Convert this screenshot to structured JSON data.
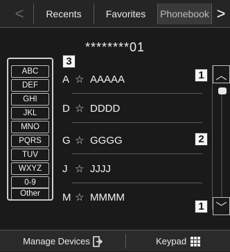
{
  "tabs": {
    "back": "<",
    "recents": "Recents",
    "favorites": "Favorites",
    "phonebook": "Phonebook",
    "forward": ">"
  },
  "phone_number": "********01",
  "index_items": [
    "ABC",
    "DEF",
    "GHI",
    "JKL",
    "MNO",
    "PQRS",
    "TUV",
    "WXYZ",
    "0-9",
    "Other"
  ],
  "callouts": {
    "index": "3",
    "scroll_up": "1",
    "scroll_mid": "2",
    "scroll_down": "1"
  },
  "contacts": [
    {
      "letter": "A",
      "star": "☆",
      "name": "AAAAA"
    },
    {
      "letter": "D",
      "star": "☆",
      "name": "DDDD"
    },
    {
      "letter": "G",
      "star": "☆",
      "name": "GGGG"
    },
    {
      "letter": "J",
      "star": "☆",
      "name": "JJJJ"
    },
    {
      "letter": "M",
      "star": "☆",
      "name": "MMMM"
    }
  ],
  "scroll": {
    "up": "︿",
    "down": "﹀"
  },
  "bottom": {
    "manage": "Manage Devices",
    "keypad": "Keypad"
  },
  "icons": {
    "manage": "device-exit-icon",
    "keypad": "keypad-grid-icon"
  }
}
